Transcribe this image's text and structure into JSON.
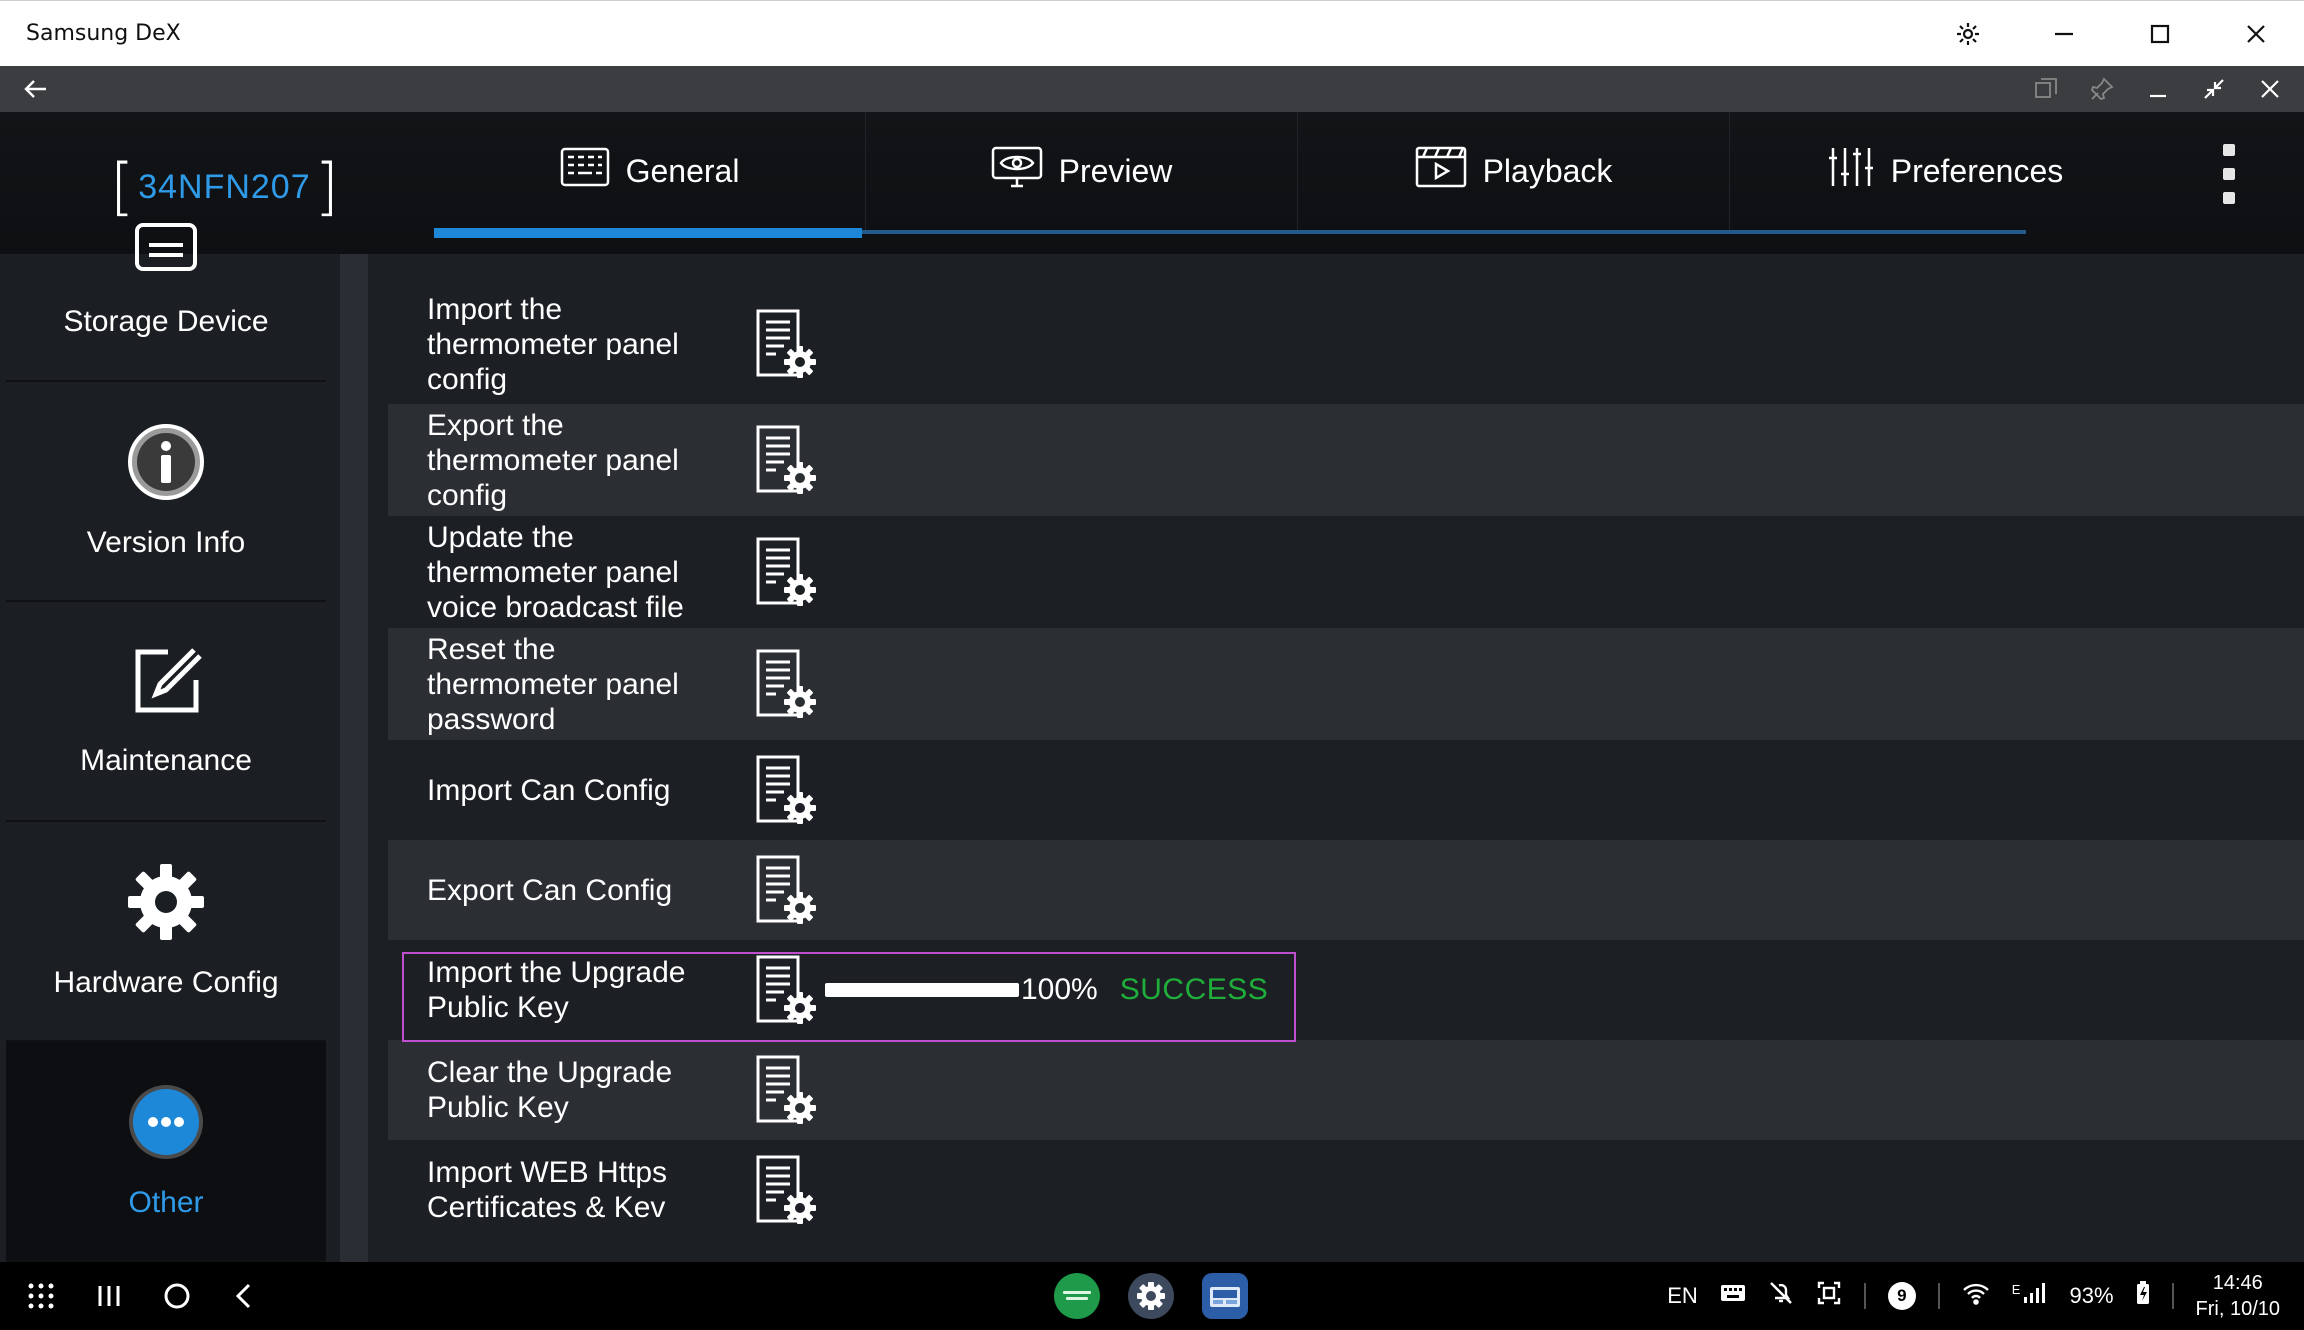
{
  "window": {
    "title": "Samsung DeX"
  },
  "header": {
    "device_id": "34NFN207",
    "tabs": [
      {
        "label": "General",
        "icon": "keyboard-icon",
        "active": true
      },
      {
        "label": "Preview",
        "icon": "eye-monitor-icon",
        "active": false
      },
      {
        "label": "Playback",
        "icon": "film-play-icon",
        "active": false
      },
      {
        "label": "Preferences",
        "icon": "sliders-icon",
        "active": false
      }
    ]
  },
  "sidebar": {
    "items": [
      {
        "label": "Storage Device",
        "icon": "storage-icon"
      },
      {
        "label": "Version Info",
        "icon": "info-icon"
      },
      {
        "label": "Maintenance",
        "icon": "edit-wrench-icon"
      },
      {
        "label": "Hardware Config",
        "icon": "gear-icon"
      },
      {
        "label": "Other",
        "icon": "more-icon",
        "active": true
      }
    ]
  },
  "list": {
    "items": [
      {
        "label": "Import the thermometer panel config"
      },
      {
        "label": "Export the thermometer panel config"
      },
      {
        "label": "Update the thermometer panel voice broadcast file"
      },
      {
        "label": "Reset the thermometer panel password"
      },
      {
        "label": "Import Can Config"
      },
      {
        "label": "Export Can Config"
      },
      {
        "label": "Import the Upgrade Public Key",
        "progress": 1.0,
        "progress_text": "100%",
        "status": "SUCCESS"
      },
      {
        "label": "Clear the Upgrade Public Key"
      },
      {
        "label": "Import WEB Https Certificates & Kev"
      }
    ]
  },
  "taskbar": {
    "language": "EN",
    "notification_count": "9",
    "network": "E",
    "battery": "93%",
    "time": "14:46",
    "date": "Fri, 10/10"
  },
  "colors": {
    "accent": "#1e88d8",
    "success": "#1fae3a",
    "highlight_border": "#c04fd0"
  }
}
